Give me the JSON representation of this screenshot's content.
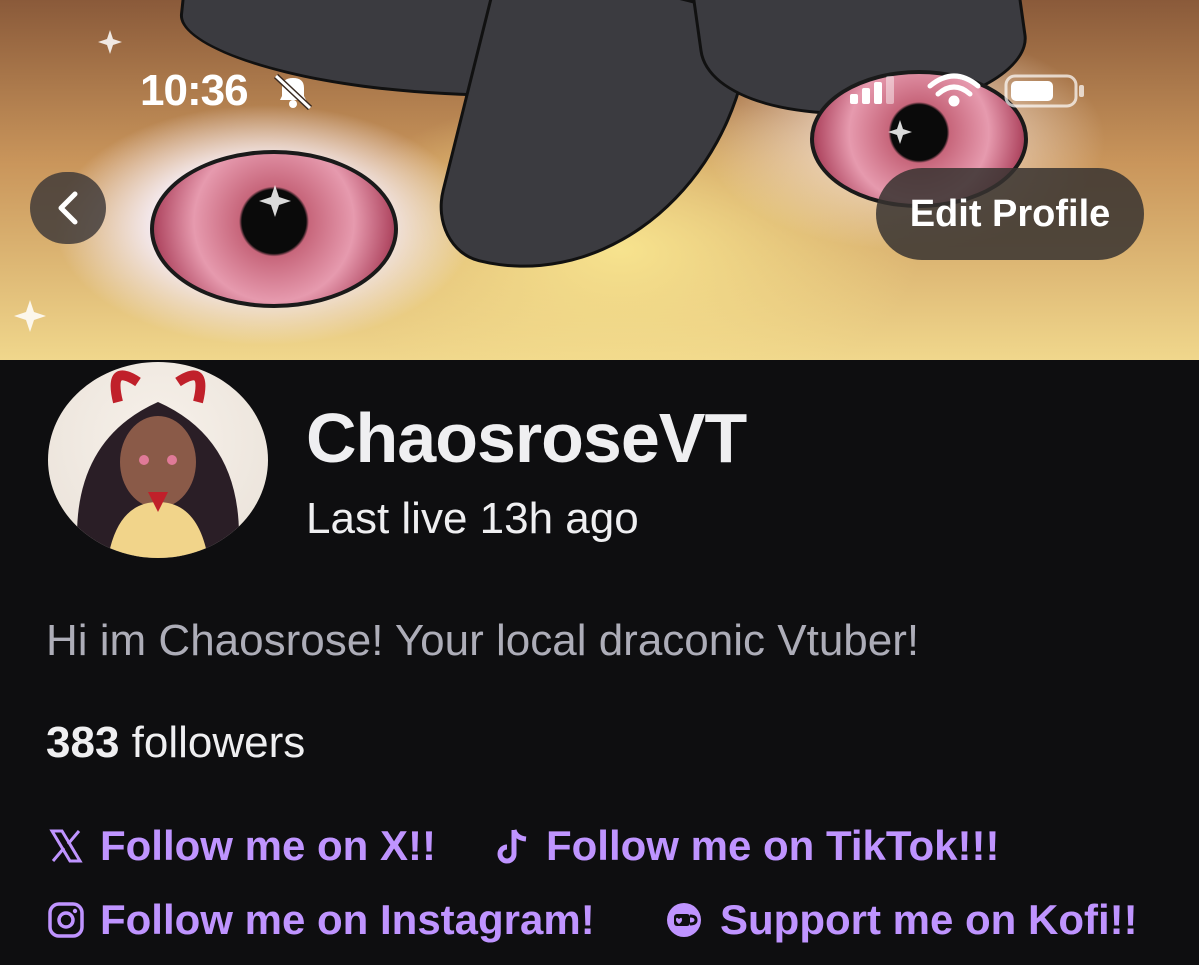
{
  "status_bar": {
    "time": "10:36"
  },
  "header": {
    "edit_label": "Edit Profile"
  },
  "profile": {
    "name": "ChaosroseVT",
    "last_live": "Last live 13h ago",
    "bio": "Hi im Chaosrose! Your local draconic Vtuber!",
    "followers_count": "383",
    "followers_label": " followers"
  },
  "links": [
    {
      "label": "Follow me on X!!",
      "icon": "x-icon"
    },
    {
      "label": "Follow me on TikTok!!!",
      "icon": "tiktok-icon"
    },
    {
      "label": "Follow me on Instagram!",
      "icon": "instagram-icon"
    },
    {
      "label": "Support me on Kofi!!",
      "icon": "kofi-icon"
    }
  ],
  "colors": {
    "background": "#0e0e10",
    "link": "#bf94ff",
    "text_primary": "#efeff1",
    "text_secondary": "#adadb8"
  }
}
